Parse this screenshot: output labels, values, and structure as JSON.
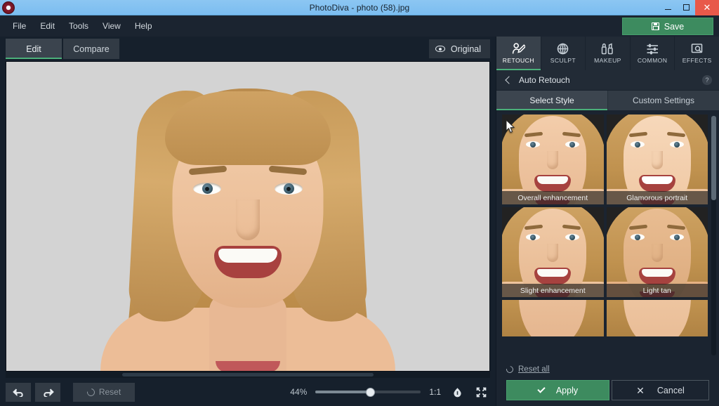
{
  "window": {
    "title": "PhotoDiva - photo (58).jpg",
    "app_icon": "photodiva-logo-icon",
    "controls": {
      "minimize": "minimize-icon",
      "maximize": "maximize-icon",
      "close": "✕"
    }
  },
  "menubar": {
    "items": [
      {
        "label": "File"
      },
      {
        "label": "Edit"
      },
      {
        "label": "Tools"
      },
      {
        "label": "View"
      },
      {
        "label": "Help"
      }
    ],
    "save_label": "Save",
    "save_icon": "floppy-disk-icon",
    "save_color": "#3d8b5f"
  },
  "editor": {
    "mode_tabs": [
      {
        "label": "Edit",
        "active": true
      },
      {
        "label": "Compare",
        "active": false
      }
    ],
    "original_label": "Original",
    "original_icon": "eye-icon"
  },
  "bottom_toolbar": {
    "undo_icon": "undo-arrow-icon",
    "redo_icon": "redo-arrow-icon",
    "reset_label": "Reset",
    "reset_icon": "reset-circle-arrow-icon",
    "zoom_percent": "44%",
    "zoom_slider_value": 52,
    "ratio_label": "1:1",
    "fit_width_icon": "fit-shape-icon",
    "fit_screen_icon": "fit-to-screen-icon"
  },
  "right_panel": {
    "category_tabs": [
      {
        "label": "RETOUCH",
        "icon": "retouch-person-icon",
        "active": true
      },
      {
        "label": "SCULPT",
        "icon": "sculpt-globe-icon",
        "active": false
      },
      {
        "label": "MAKEUP",
        "icon": "makeup-lipstick-icon",
        "active": false
      },
      {
        "label": "COMMON",
        "icon": "common-sliders-icon",
        "active": false
      },
      {
        "label": "EFFECTS",
        "icon": "effects-frame-icon",
        "active": false
      }
    ],
    "section": {
      "back_icon": "back-chevron-icon",
      "title": "Auto Retouch",
      "help_icon": "help-question-icon",
      "help_glyph": "?"
    },
    "sub_tabs": [
      {
        "label": "Select Style",
        "active": true
      },
      {
        "label": "Custom Settings",
        "active": false
      }
    ],
    "styles": [
      {
        "label": "Overall enhancement",
        "variant": "full"
      },
      {
        "label": "Glamorous portrait",
        "variant": "full"
      },
      {
        "label": "Slight enhancement",
        "variant": "full"
      },
      {
        "label": "Light tan",
        "variant": "full"
      },
      {
        "label": "",
        "variant": "eyes"
      },
      {
        "label": "",
        "variant": "eyes"
      }
    ],
    "footer": {
      "reset_all_label": "Reset all",
      "reset_all_icon": "reset-circle-arrow-icon",
      "apply_label": "Apply",
      "apply_icon": "check-icon",
      "cancel_label": "Cancel",
      "cancel_icon": "close-x-icon",
      "apply_color": "#3d8b5f"
    }
  },
  "theme": {
    "titlebar": "#8cc6f2",
    "panel_bg": "#1b2430",
    "tab_bg": "#323b45",
    "accent_green": "#4bb07a",
    "canvas_bg": "#d4d4d4"
  }
}
